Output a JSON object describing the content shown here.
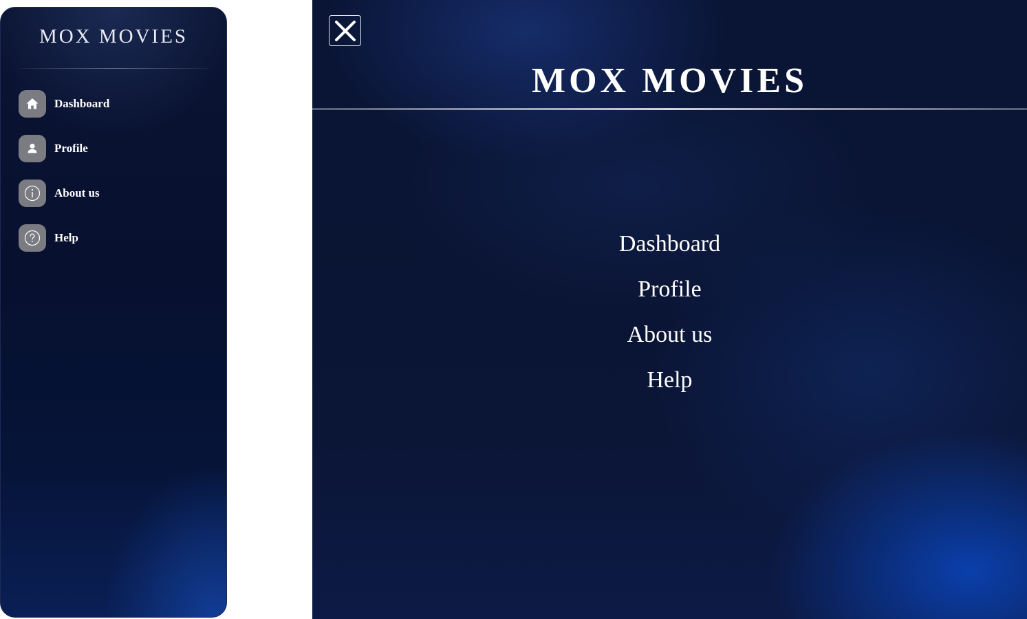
{
  "sidebar": {
    "brand": "MOX MOVIES",
    "items": [
      {
        "label": "Dashboard",
        "icon": "home-icon"
      },
      {
        "label": "Profile",
        "icon": "user-icon"
      },
      {
        "label": "About us",
        "icon": "info-icon"
      },
      {
        "label": "Help",
        "icon": "help-icon"
      }
    ]
  },
  "mobile_menu": {
    "brand": "MOX MOVIES",
    "close_icon": "close-icon",
    "items": [
      {
        "label": "Dashboard"
      },
      {
        "label": "Profile"
      },
      {
        "label": "About us"
      },
      {
        "label": "Help"
      }
    ]
  },
  "colors": {
    "background_dark": "#07102f",
    "accent_blue": "#0a46be",
    "icon_tile": "#7a7c82",
    "text": "#ffffff"
  }
}
